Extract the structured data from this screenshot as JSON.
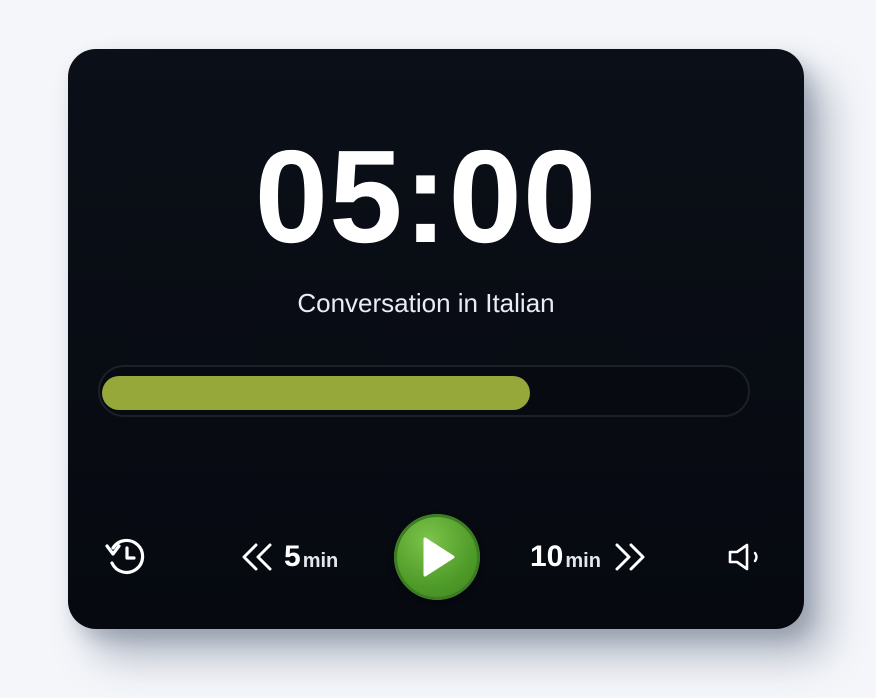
{
  "timer": {
    "display": "05:00",
    "label": "Conversation in Italian"
  },
  "progress": {
    "fraction": 0.665,
    "fill_color": "#96a83a"
  },
  "controls": {
    "history_icon": "history-icon",
    "rewind": {
      "amount": "5",
      "unit": "min",
      "icon": "double-chevron-left-icon"
    },
    "play_icon": "play-icon",
    "play_color": "#5aa830",
    "forward": {
      "amount": "10",
      "unit": "min",
      "icon": "double-chevron-right-icon"
    },
    "volume_icon": "volume-icon"
  },
  "colors": {
    "background": "#f4f6fa",
    "card": "#0a0d15",
    "text": "#ffffff"
  }
}
